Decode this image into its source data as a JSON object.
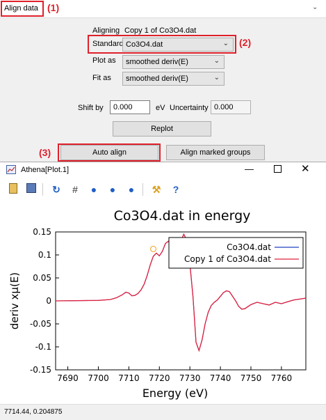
{
  "header": {
    "label": "Align data",
    "chevron": "chevron-down-icon"
  },
  "annotations": {
    "a1": "(1)",
    "a2": "(2)",
    "a3": "(3)"
  },
  "form": {
    "aligning_label": "Aligning",
    "aligning_value": "Copy 1 of Co3O4.dat",
    "standard_label": "Standard",
    "standard_value": "Co3O4.dat",
    "plot_as_label": "Plot as",
    "plot_as_value": "smoothed deriv(E)",
    "fit_as_label": "Fit as",
    "fit_as_value": "smoothed deriv(E)",
    "shift_label": "Shift by",
    "shift_value": "0.000",
    "shift_unit": "eV",
    "uncertainty_label": "Uncertainty",
    "uncertainty_value": "0.000"
  },
  "buttons": {
    "replot": "Replot",
    "auto_align": "Auto align",
    "align_marked": "Align marked groups"
  },
  "plot_window": {
    "title": "Athena[Plot.1]",
    "toolbar_icons": [
      "clipboard-icon",
      "save-icon",
      "refresh-icon",
      "grid-icon",
      "zoom-left-icon",
      "zoom-right-icon",
      "zoom-reset-icon",
      "settings-icon",
      "help-icon"
    ],
    "status": "7714.44, 0.204875"
  },
  "colors": {
    "series1": "#2040c0",
    "series2": "#e0203c",
    "highlight": "#e0202a"
  },
  "chart_data": {
    "type": "line",
    "title": "Co3O4.dat in energy",
    "xlabel": "Energy (eV)",
    "ylabel": "deriv xμ(E)",
    "xlim": [
      7686,
      7768
    ],
    "ylim": [
      -0.15,
      0.15
    ],
    "xticks": [
      7690,
      7700,
      7710,
      7720,
      7730,
      7740,
      7750,
      7760
    ],
    "yticks": [
      -0.15,
      -0.1,
      -0.05,
      0,
      0.05,
      0.1,
      0.15
    ],
    "ytick_labels": [
      "-0.15",
      "-0.1",
      "-0.05",
      "0",
      "0.05",
      "0.1",
      "0.15"
    ],
    "legend_position": "top-right",
    "marker": {
      "x": 7718,
      "y": 0.113
    },
    "series": [
      {
        "name": "Co3O4.dat",
        "x": [
          7686,
          7700,
          7704,
          7706,
          7708,
          7709,
          7710,
          7711,
          7712,
          7713,
          7714,
          7715,
          7716,
          7717,
          7718,
          7719,
          7720,
          7721,
          7722,
          7723,
          7724,
          7725,
          7726,
          7727,
          7728,
          7729,
          7730,
          7731,
          7732,
          7733,
          7734,
          7735,
          7736,
          7737,
          7738,
          7739,
          7740,
          7741,
          7742,
          7743,
          7744,
          7745,
          7746,
          7747,
          7748,
          7750,
          7752,
          7754,
          7756,
          7758,
          7760,
          7762,
          7764,
          7766,
          7768
        ],
        "y": [
          0,
          0.001,
          0.003,
          0.007,
          0.014,
          0.019,
          0.017,
          0.011,
          0.012,
          0.016,
          0.024,
          0.036,
          0.055,
          0.078,
          0.097,
          0.104,
          0.098,
          0.108,
          0.125,
          0.13,
          0.115,
          0.095,
          0.1,
          0.13,
          0.145,
          0.132,
          0.08,
          0.01,
          -0.09,
          -0.108,
          -0.085,
          -0.05,
          -0.025,
          -0.01,
          -0.003,
          0.002,
          0.01,
          0.018,
          0.022,
          0.02,
          0.01,
          0.0,
          -0.012,
          -0.018,
          -0.017,
          -0.008,
          -0.003,
          -0.006,
          -0.009,
          -0.003,
          -0.006,
          -0.002,
          0.002,
          0.004,
          0.006
        ]
      },
      {
        "name": "Copy 1 of Co3O4.dat",
        "x": [
          7686,
          7700,
          7704,
          7706,
          7708,
          7709,
          7710,
          7711,
          7712,
          7713,
          7714,
          7715,
          7716,
          7717,
          7718,
          7719,
          7720,
          7721,
          7722,
          7723,
          7724,
          7725,
          7726,
          7727,
          7728,
          7729,
          7730,
          7731,
          7732,
          7733,
          7734,
          7735,
          7736,
          7737,
          7738,
          7739,
          7740,
          7741,
          7742,
          7743,
          7744,
          7745,
          7746,
          7747,
          7748,
          7750,
          7752,
          7754,
          7756,
          7758,
          7760,
          7762,
          7764,
          7766,
          7768
        ],
        "y": [
          0,
          0.001,
          0.003,
          0.007,
          0.014,
          0.019,
          0.017,
          0.011,
          0.012,
          0.016,
          0.024,
          0.036,
          0.055,
          0.078,
          0.097,
          0.104,
          0.098,
          0.108,
          0.125,
          0.13,
          0.115,
          0.095,
          0.1,
          0.13,
          0.145,
          0.132,
          0.08,
          0.01,
          -0.09,
          -0.108,
          -0.085,
          -0.05,
          -0.025,
          -0.01,
          -0.003,
          0.002,
          0.01,
          0.018,
          0.022,
          0.02,
          0.01,
          0.0,
          -0.012,
          -0.018,
          -0.017,
          -0.008,
          -0.003,
          -0.006,
          -0.009,
          -0.003,
          -0.006,
          -0.002,
          0.002,
          0.004,
          0.006
        ]
      }
    ]
  }
}
